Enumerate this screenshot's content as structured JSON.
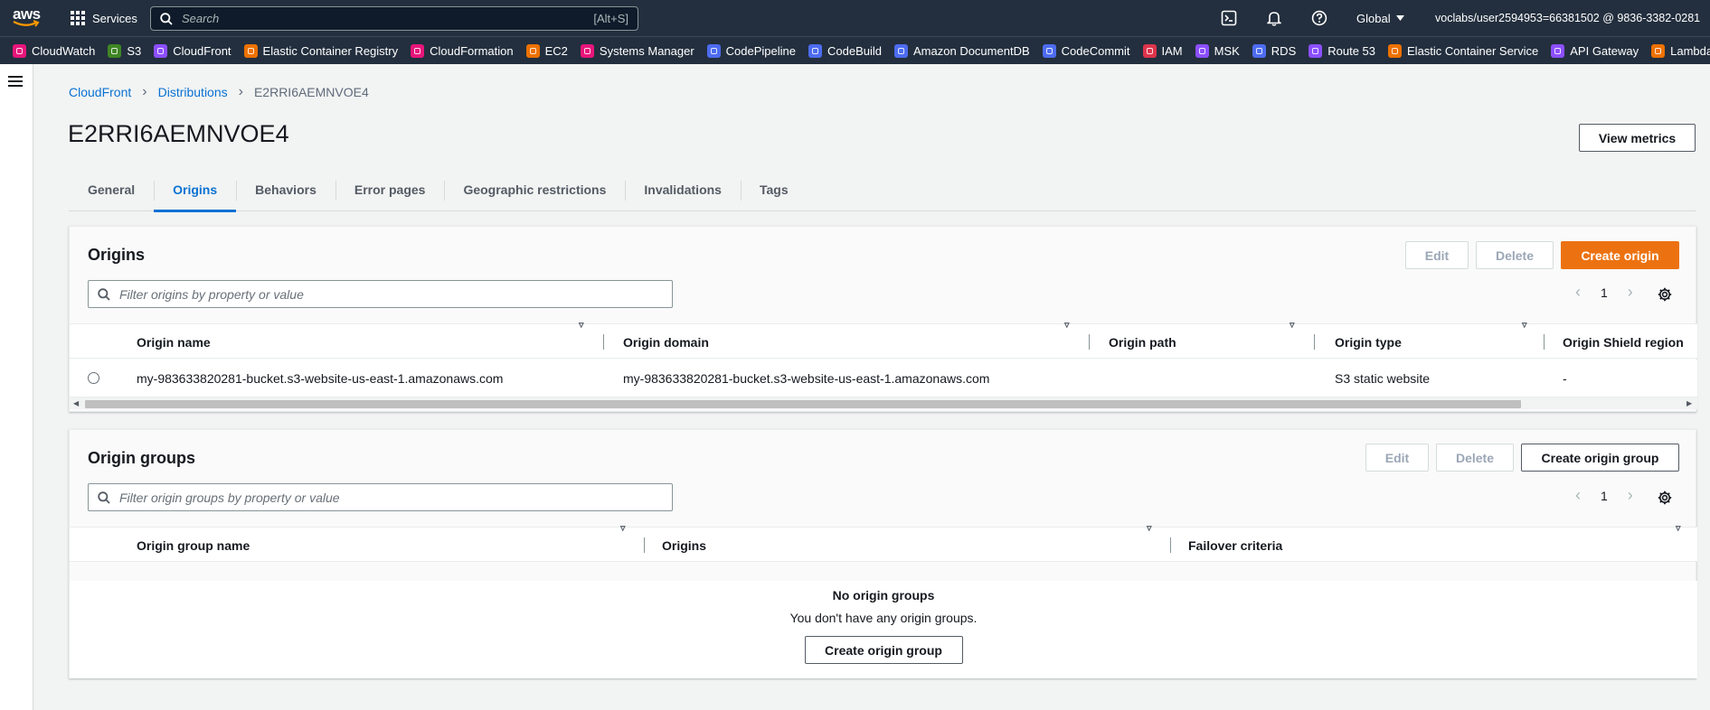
{
  "topnav": {
    "logo_text": "aws",
    "services_label": "Services",
    "search_placeholder": "Search",
    "search_shortcut": "[Alt+S]",
    "region_label": "Global",
    "account_label": "voclabs/user2594953=66381502 @ 9836-3382-0281"
  },
  "favorites": [
    {
      "label": "CloudWatch",
      "color": "#e7157b"
    },
    {
      "label": "S3",
      "color": "#3f8624"
    },
    {
      "label": "CloudFront",
      "color": "#8c4fff"
    },
    {
      "label": "Elastic Container Registry",
      "color": "#ed7100"
    },
    {
      "label": "CloudFormation",
      "color": "#e7157b"
    },
    {
      "label": "EC2",
      "color": "#ed7100"
    },
    {
      "label": "Systems Manager",
      "color": "#e7157b"
    },
    {
      "label": "CodePipeline",
      "color": "#4d6cf0"
    },
    {
      "label": "CodeBuild",
      "color": "#4d6cf0"
    },
    {
      "label": "Amazon DocumentDB",
      "color": "#4d6cf0"
    },
    {
      "label": "CodeCommit",
      "color": "#4d6cf0"
    },
    {
      "label": "IAM",
      "color": "#dd344c"
    },
    {
      "label": "MSK",
      "color": "#8c4fff"
    },
    {
      "label": "RDS",
      "color": "#4d6cf0"
    },
    {
      "label": "Route 53",
      "color": "#8c4fff"
    },
    {
      "label": "Elastic Container Service",
      "color": "#ed7100"
    },
    {
      "label": "API Gateway",
      "color": "#8c4fff"
    },
    {
      "label": "Lambda",
      "color": "#ed7100"
    }
  ],
  "breadcrumb": {
    "items": [
      "CloudFront",
      "Distributions"
    ],
    "current": "E2RRI6AEMNVOE4"
  },
  "page": {
    "title": "E2RRI6AEMNVOE4",
    "view_metrics_label": "View metrics"
  },
  "tabs": [
    {
      "label": "General",
      "active": false
    },
    {
      "label": "Origins",
      "active": true
    },
    {
      "label": "Behaviors",
      "active": false
    },
    {
      "label": "Error pages",
      "active": false
    },
    {
      "label": "Geographic restrictions",
      "active": false
    },
    {
      "label": "Invalidations",
      "active": false
    },
    {
      "label": "Tags",
      "active": false
    }
  ],
  "origins": {
    "title": "Origins",
    "edit_label": "Edit",
    "delete_label": "Delete",
    "create_label": "Create origin",
    "filter_placeholder": "Filter origins by property or value",
    "page_number": "1",
    "columns": [
      "Origin name",
      "Origin domain",
      "Origin path",
      "Origin type",
      "Origin Shield region"
    ],
    "rows": [
      {
        "name": "my-983633820281-bucket.s3-website-us-east-1.amazonaws.com",
        "domain": "my-983633820281-bucket.s3-website-us-east-1.amazonaws.com",
        "path": "",
        "type": "S3 static website",
        "shield_region": "-"
      }
    ]
  },
  "origin_groups": {
    "title": "Origin groups",
    "edit_label": "Edit",
    "delete_label": "Delete",
    "create_label": "Create origin group",
    "filter_placeholder": "Filter origin groups by property or value",
    "page_number": "1",
    "columns": [
      "Origin group name",
      "Origins",
      "Failover criteria"
    ],
    "empty_title": "No origin groups",
    "empty_subtitle": "You don't have any origin groups.",
    "empty_create_label": "Create origin group"
  }
}
